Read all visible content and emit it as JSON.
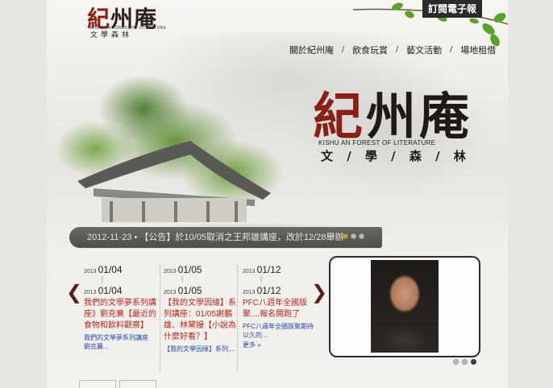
{
  "header": {
    "logo_main_a": "紀",
    "logo_main_b": "州庵",
    "logo_sub_en": "KISHU AN FOREST OF LITERATURE",
    "logo_sub": "文學森林",
    "subscribe_label": "訂閱電子報"
  },
  "nav": {
    "items": [
      "關於紀州庵",
      "飲食玩賞",
      "藝文活動",
      "場地租借"
    ],
    "separator": "/"
  },
  "hero": {
    "title_a": "紀",
    "title_b": "州庵",
    "subtitle_en": "KISHU AN FOREST OF LITERATURE",
    "subtitle": "文 / 學 / 森 / 林"
  },
  "announcement": {
    "text": "2012-11-23 • 【公告】於10/05取消之王邦雄講座，改於12/28舉辦"
  },
  "events": [
    {
      "year1": "2013",
      "date1": "01/04",
      "year2": "2013",
      "date2": "01/04",
      "title": "我們的文學夢系列講座》劉克襄【最近的食物和飲料觀察】",
      "desc": "我們的文學夢系列講座 劉克襄..."
    },
    {
      "year1": "2013",
      "date1": "01/05",
      "year2": "2013",
      "date2": "01/05",
      "title": "【我的文學因緣】系列講座：01/05謝鵬雄、林黛嫚【小說為什麼好看？】",
      "desc": "【我的文學因緣】系列..."
    },
    {
      "year1": "2013",
      "date1": "01/12",
      "year2": "2013",
      "date2": "01/12",
      "title": "PFC八週年全國版聚....報名開跑了",
      "desc": "PFC八週年全國版聚期待以久的...",
      "more": "更多 »"
    }
  ],
  "arrows": {
    "prev": "❮",
    "next": "❯"
  },
  "colors": {
    "accent": "#8b1e17",
    "link": "#2a46a8",
    "event_title": "#b5261c",
    "bar": "#55534f"
  }
}
